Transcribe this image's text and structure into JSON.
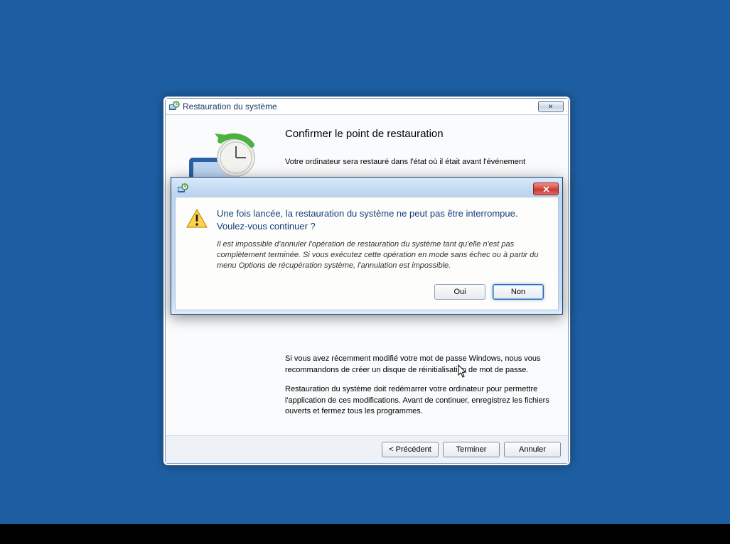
{
  "wizard": {
    "title": "Restauration du système",
    "close_glyph": "✕",
    "heading": "Confirmer le point de restauration",
    "intro": "Votre ordinateur sera restauré dans l'état où il était avant l'événement",
    "password_note": "Si vous avez récemment modifié votre mot de passe Windows, nous vous recommandons de créer un disque de réinitialisation de mot de passe.",
    "restart_note": "Restauration du système doit redémarrer votre ordinateur pour permettre l'application de ces modifications. Avant de continuer, enregistrez les fichiers ouverts et fermez tous les programmes.",
    "back_label": "< Précédent",
    "finish_label": "Terminer",
    "cancel_label": "Annuler"
  },
  "dialog": {
    "heading": "Une fois lancée, la restauration du système ne peut pas être interrompue. Voulez-vous continuer ?",
    "body": "Il est impossible d'annuler l'opération de restauration du système tant qu'elle n'est pas complètement terminée. Si vous exécutez cette opération en mode sans échec ou à partir du menu Options de récupération système, l'annulation est impossible.",
    "yes_label": "Oui",
    "no_label": "Non"
  }
}
